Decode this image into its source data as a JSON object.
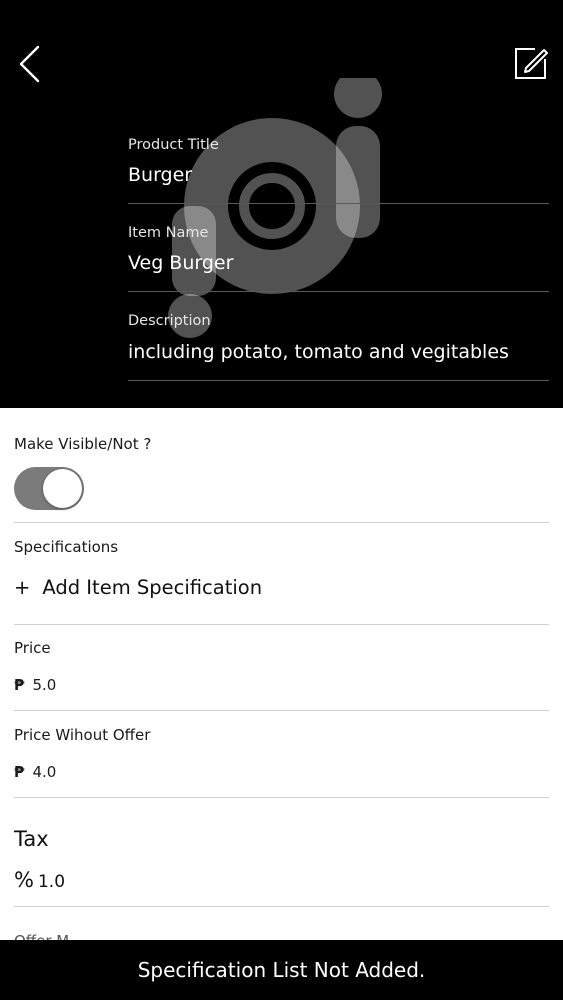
{
  "header": {
    "product_title": {
      "label": "Product Title",
      "value": "Burger"
    },
    "item_name": {
      "label": "Item Name",
      "value": "Veg Burger"
    },
    "description": {
      "label": "Description",
      "value": "including potato, tomato and vegitables"
    }
  },
  "visibility": {
    "label": "Make Visible/Not ?",
    "on": true
  },
  "specifications": {
    "label": "Specifications",
    "add_symbol": "+",
    "add_label": "Add Item Specification"
  },
  "price": {
    "label": "Price",
    "currency": "₱",
    "value": "5.0"
  },
  "price_without_offer": {
    "label": "Price Wihout Offer",
    "currency": "₱",
    "value": "4.0"
  },
  "tax": {
    "label": "Tax",
    "symbol": "%",
    "value": "1.0"
  },
  "cut_off_label": "Offer M",
  "toast": {
    "message": "Specification List Not Added."
  },
  "colors": {
    "header_bg": "#000000",
    "toggle_track": "#7b7b7b",
    "separator": "#cfcfcf"
  },
  "icons": {
    "back": "chevron-left-icon",
    "edit": "edit-pencil-icon",
    "logo": "brand-logo-icon"
  }
}
